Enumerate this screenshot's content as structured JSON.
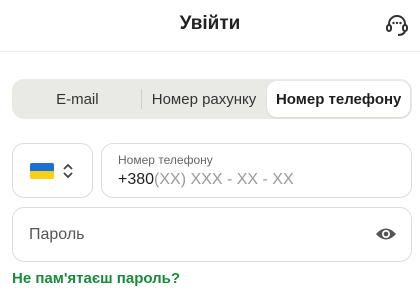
{
  "header": {
    "title": "Увійти",
    "support_icon": "headset-icon"
  },
  "tabs": [
    {
      "label": "E-mail",
      "active": false
    },
    {
      "label": "Номер рахунку",
      "active": false
    },
    {
      "label": "Номер телефону",
      "active": true
    }
  ],
  "country": {
    "flag": "ukraine-flag",
    "flag_colors": [
      "#1f6fd1",
      "#f7d117"
    ]
  },
  "phone": {
    "label": "Номер телефону",
    "prefix": "+380",
    "mask": "(XX) XXX - XX - XX"
  },
  "password": {
    "placeholder": "Пароль",
    "toggle_icon": "eye-icon"
  },
  "forgot_password": {
    "label": "Не пам'ятаєш пароль?",
    "color": "#1a8a3c"
  }
}
